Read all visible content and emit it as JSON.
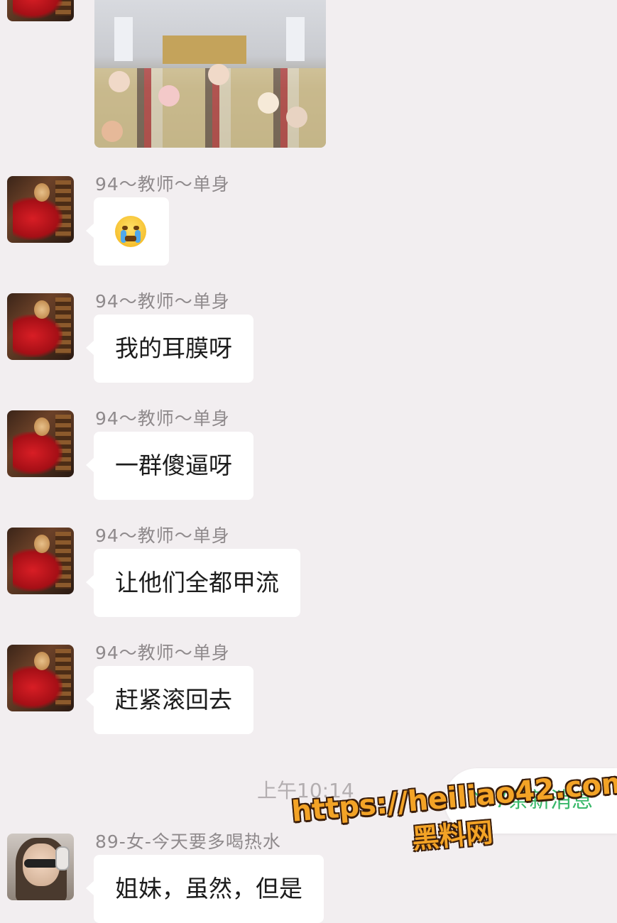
{
  "chat": {
    "image_message": {
      "alt": "classroom-photo"
    },
    "messages": [
      {
        "sender": "94～教师～单身",
        "text": "",
        "emoji": "crying-face-emoji"
      },
      {
        "sender": "94～教师～单身",
        "text": "我的耳膜呀"
      },
      {
        "sender": "94～教师～单身",
        "text": "一群傻逼呀"
      },
      {
        "sender": "94～教师～单身",
        "text": "让他们全都甲流"
      },
      {
        "sender": "94～教师～单身",
        "text": "赶紧滚回去"
      },
      {
        "sender": "89-女-今天要多喝热水",
        "text": "姐妹，虽然，但是"
      }
    ],
    "timestamp": "上午10:14",
    "new_messages_pill": "7条新消息"
  },
  "watermark": {
    "url": "https://heiliao42.com",
    "site_name": "黑料网"
  },
  "colors": {
    "background": "#f2eef0",
    "bubble": "#ffffff",
    "accent_green": "#39b86a",
    "watermark_orange": "#f3a326"
  }
}
